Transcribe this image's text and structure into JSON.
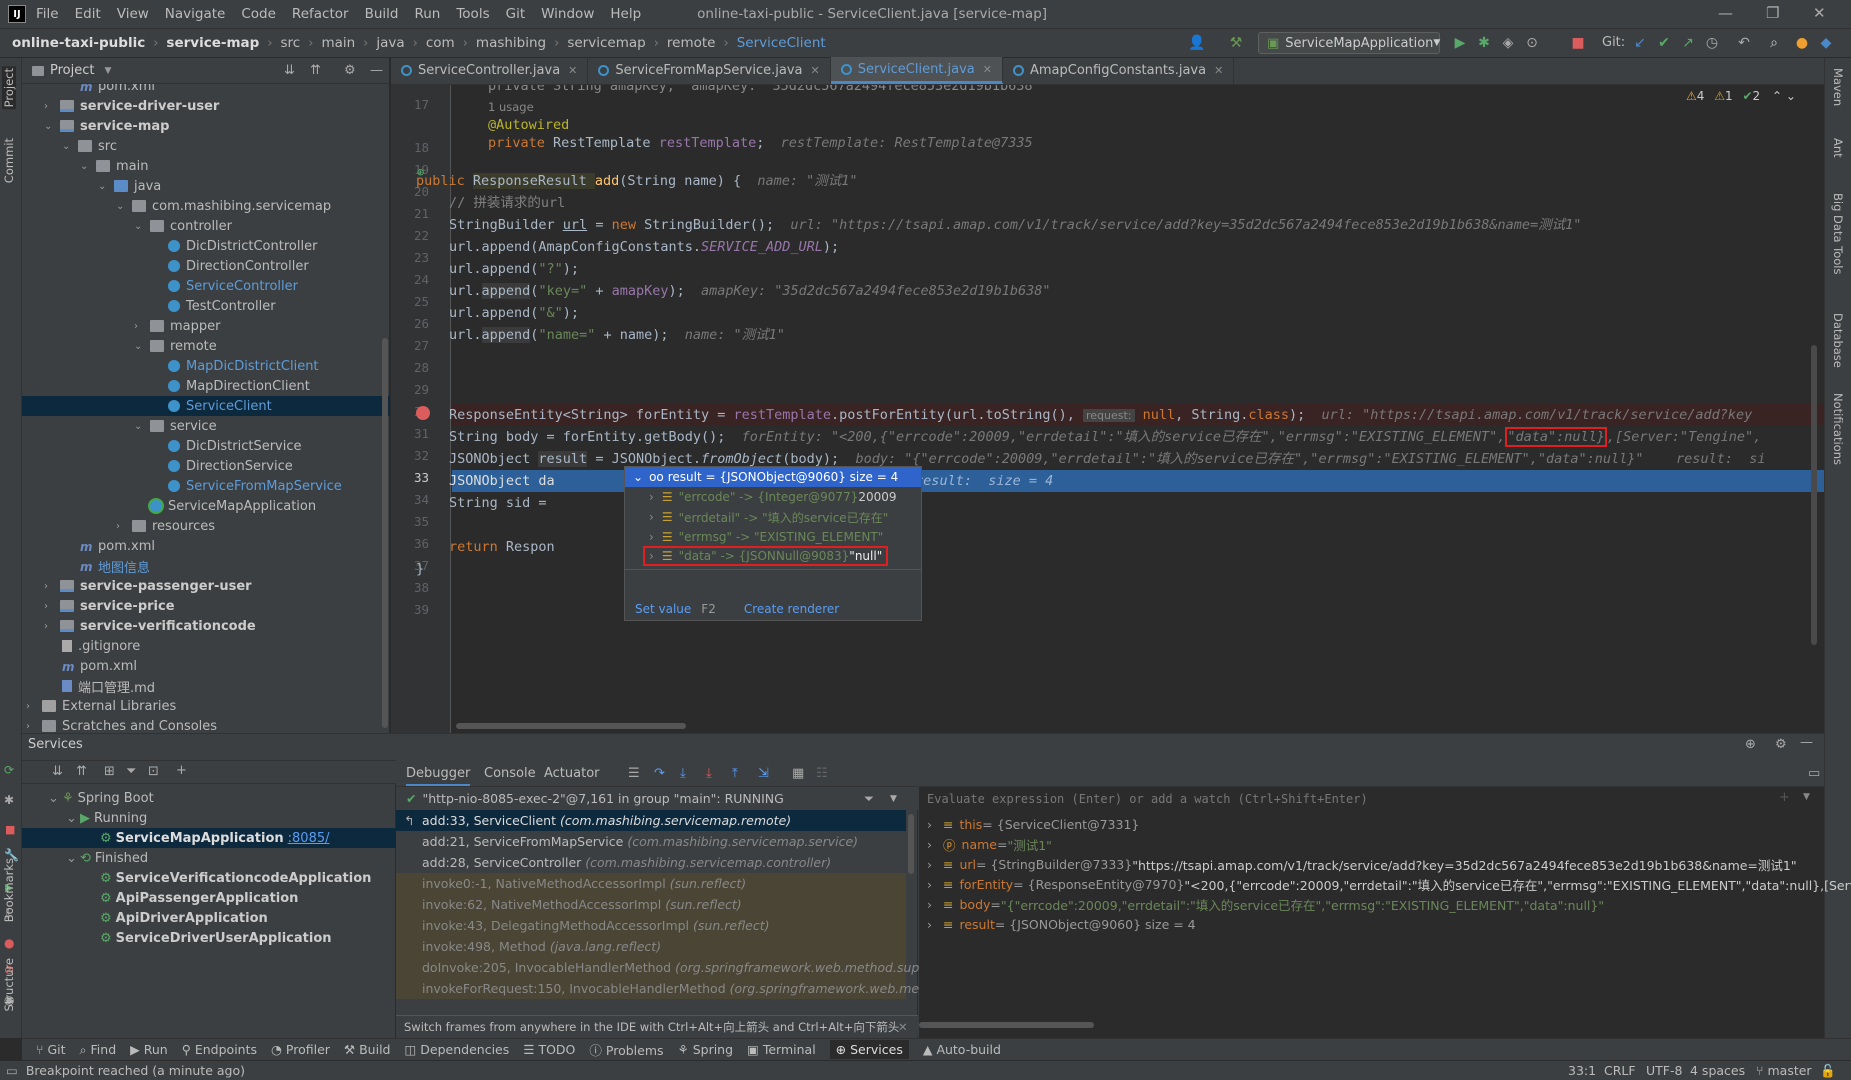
{
  "menu": {
    "items": [
      "File",
      "Edit",
      "View",
      "Navigate",
      "Code",
      "Refactor",
      "Build",
      "Run",
      "Tools",
      "Git",
      "Window",
      "Help"
    ],
    "window_title": "online-taxi-public - ServiceClient.java [service-map]"
  },
  "nav": {
    "crumbs": [
      "online-taxi-public",
      "service-map",
      "src",
      "main",
      "java",
      "com",
      "mashibing",
      "servicemap",
      "remote",
      "ServiceClient"
    ],
    "run_config": "ServiceMapApplication",
    "git_label": "Git:"
  },
  "project": {
    "title": "Project",
    "items": [
      {
        "t": "pom.xml"
      },
      {
        "t": "service-driver-user"
      },
      {
        "t": "service-map"
      },
      {
        "t": "src"
      },
      {
        "t": "main"
      },
      {
        "t": "java"
      },
      {
        "t": "com.mashibing.servicemap"
      },
      {
        "t": "controller"
      },
      {
        "t": "DicDistrictController"
      },
      {
        "t": "DirectionController"
      },
      {
        "t": "ServiceController"
      },
      {
        "t": "TestController"
      },
      {
        "t": "mapper"
      },
      {
        "t": "remote"
      },
      {
        "t": "MapDicDistrictClient"
      },
      {
        "t": "MapDirectionClient"
      },
      {
        "t": "ServiceClient"
      },
      {
        "t": "service"
      },
      {
        "t": "DicDistrictService"
      },
      {
        "t": "DirectionService"
      },
      {
        "t": "ServiceFromMapService"
      },
      {
        "t": "ServiceMapApplication"
      },
      {
        "t": "resources"
      },
      {
        "t": "pom.xml"
      },
      {
        "t": "地图信息"
      },
      {
        "t": "service-passenger-user"
      },
      {
        "t": "service-price"
      },
      {
        "t": "service-verificationcode"
      },
      {
        "t": ".gitignore"
      },
      {
        "t": "pom.xml"
      },
      {
        "t": "端口管理.md"
      },
      {
        "t": "External Libraries"
      },
      {
        "t": "Scratches and Consoles"
      }
    ]
  },
  "tabs": [
    "ServiceController.java",
    "ServiceFromMapService.java",
    "ServiceClient.java",
    "AmapConfigConstants.java"
  ],
  "editor": {
    "inspections": {
      "warn": "4",
      "weak": "1",
      "ok": "2"
    },
    "usage": "1 usage",
    "lines": [
      "17",
      "18",
      "19",
      "20",
      "21",
      "22",
      "23",
      "24",
      "25",
      "26",
      "27",
      "28",
      "29",
      "30",
      "31",
      "32",
      "33",
      "34",
      "35",
      "36",
      "37",
      "38",
      "39"
    ],
    "code": {
      "l17": "private String amapKey;  amapKey: \"35d2dc567a2494fece853e2d19b1b638\"",
      "l18a": "@Autowired",
      "l19a": "private ",
      "l19b": "RestTemplate ",
      "l19c": "restTemplate",
      "l19d": ";",
      "l19h": "restTemplate: RestTemplate@7335",
      "l21a": "public ",
      "l21b": "ResponseResult ",
      "l21c": "add",
      "l21d": "(String name) {",
      "l21h": "name: \"测试1\"",
      "l22": "// 拼装请求的url",
      "l23a": "StringBuilder ",
      "l23b": "url",
      " l23c": " = ",
      "l23d": "new ",
      "l23e": "StringBuilder();",
      "l23h": "url: \"https://tsapi.amap.com/v1/track/service/add?key=35d2dc567a2494fece853e2d19b1b638&name=测试1\"",
      "l24a": "url.append(AmapConfigConstants.",
      "l24b": "SERVICE_ADD_URL",
      "l24c": ");",
      "l25a": "url.append(",
      "l25b": "\"?\"",
      "l25c": ");",
      "l26a": "url.",
      "l26b": "append",
      "l26c": "(",
      "l26d": "\"key=\"",
      "l26e": " + ",
      "l26f": "amapKey",
      "l26g": ");",
      "l26h": "amapKey: \"35d2dc567a2494fece853e2d19b1b638\"",
      "l27a": "url.append(",
      "l27b": "\"&\"",
      "l27c": ");",
      "l28a": "url.",
      "l28b": "append",
      "l28c": "(",
      "l28d": "\"name=\"",
      "l28e": " + name);",
      "l28h": "name: \"测试1\"",
      "l30a": "ResponseEntity<String> forEntity = ",
      "l30b": "restTemplate",
      "l30c": ".postForEntity(url.toString(), ",
      "l30r": "request:",
      "l30d": " null",
      ", l30e": ", String.",
      "l30f": "class",
      "l30g": ");",
      "l30h": "url: \"https://tsapi.amap.com/v1/track/service/add?key",
      "l31a": "String body = forEntity.getBody();",
      "l31h": "forEntity: \"<200,{\"errcode\":20009,\"errdetail\":\"填入的service已存在\",\"errmsg\":\"EXISTING_ELEMENT\",",
      "l31r": "\"data\":null}",
      "l31t": ",[Server:\"Tengine\",",
      "l32a": "JSONObject ",
      "l32b": "result",
      " l32c": " = JSONObject.",
      "l32d": "fromObject",
      "l32e": "(body);",
      "l32h": "body: \"{\"errcode\":20009,\"errdetail\":\"填入的service已存在\",\"errmsg\":\"EXISTING_ELEMENT\",\"data\":null}\"    result:  si",
      "l33a": "JSONObject da",
      "l33h": ";  result:  size = 4",
      "l34a": "String sid = ",
      "l36a": "return ",
      "l36b": "Respon",
      "l37": "}",
      "l38": "}"
    }
  },
  "popup": {
    "header": "result = {JSONObject@9060}  size = 4",
    "rows": [
      {
        "k": "\"errcode\" -> {Integer@9077} ",
        "v": "20009"
      },
      {
        "k": "\"errdetail\" -> \"填入的service已存在\"",
        "v": ""
      },
      {
        "k": "\"errmsg\" -> \"EXISTING_ELEMENT\"",
        "v": ""
      },
      {
        "k": "\"data\" -> {JSONNull@9083} ",
        "v": "\"null\""
      }
    ],
    "set_value": "Set value",
    "set_value_key": "F2",
    "create_renderer": "Create renderer"
  },
  "services": {
    "title": "Services",
    "tree": {
      "spring_boot": "Spring Boot",
      "running": "Running",
      "app": "ServiceMapApplication",
      "port": ":8085/",
      "finished": "Finished",
      "finished_apps": [
        "ServiceVerificationcodeApplication",
        "ApiPassengerApplication",
        "ApiDriverApplication",
        "ServiceDriverUserApplication"
      ]
    },
    "debug_tabs": [
      "Debugger",
      "Console",
      "Actuator"
    ],
    "thread": "\"http-nio-8085-exec-2\"@7,161 in group \"main\": RUNNING",
    "frames": [
      {
        "m": "add:33, ServiceClient",
        "p": "(com.mashibing.servicemap.remote)"
      },
      {
        "m": "add:21, ServiceFromMapService",
        "p": "(com.mashibing.servicemap.service)"
      },
      {
        "m": "add:28, ServiceController",
        "p": "(com.mashibing.servicemap.controller)"
      },
      {
        "m": "invoke0:-1, NativeMethodAccessorImpl",
        "p": "(sun.reflect)"
      },
      {
        "m": "invoke:62, NativeMethodAccessorImpl",
        "p": "(sun.reflect)"
      },
      {
        "m": "invoke:43, DelegatingMethodAccessorImpl",
        "p": "(sun.reflect)"
      },
      {
        "m": "invoke:498, Method",
        "p": "(java.lang.reflect)"
      },
      {
        "m": "doInvoke:205, InvocableHandlerMethod",
        "p": "(org.springframework.web.method.support)"
      },
      {
        "m": "invokeForRequest:150, InvocableHandlerMethod",
        "p": "(org.springframework.web.method."
      }
    ],
    "frames_hint": "Switch frames from anywhere in the IDE with Ctrl+Alt+向上箭头 and Ctrl+Alt+向下箭头",
    "eval_placeholder": "Evaluate expression (Enter) or add a watch (Ctrl+Shift+Enter)",
    "vars": [
      {
        "n": "this",
        "t": " = {ServiceClient@7331}",
        "v": ""
      },
      {
        "n": "name",
        "t": " = ",
        "v": "\"测试1\""
      },
      {
        "n": "url",
        "t": " = {StringBuilder@7333} ",
        "v": "\"https://tsapi.amap.com/v1/track/service/add?key=35d2dc567a2494fece853e2d19b1b638&name=测试1\""
      },
      {
        "n": "forEntity",
        "t": " = {ResponseEntity@7970} ",
        "v": "\"<200,{\"errcode\":20009,\"errdetail\":\"填入的service已存在\",\"errmsg\":\"EXISTING_ELEMENT\",\"data\":null},[Serve ... View"
      },
      {
        "n": "body",
        "t": " = ",
        "v": "\"{\"errcode\":20009,\"errdetail\":\"填入的service已存在\",\"errmsg\":\"EXISTING_ELEMENT\",\"data\":null}\""
      },
      {
        "n": "result",
        "t": " = {JSONObject@9060}  size = 4",
        "v": ""
      }
    ]
  },
  "bottom_tools": [
    "Git",
    "Find",
    "Run",
    "Endpoints",
    "Profiler",
    "Build",
    "Dependencies",
    "TODO",
    "Problems",
    "Spring",
    "Terminal",
    "Services",
    "Auto-build"
  ],
  "left_stripe": [
    "Project",
    "Commit",
    "Bookmarks",
    "Structure"
  ],
  "right_stripe": [
    "Maven",
    "Ant",
    "Big Data Tools",
    "Database",
    "Notifications"
  ],
  "status": {
    "message": "Breakpoint reached (a minute ago)",
    "pos": "33:1",
    "sep": "CRLF",
    "enc": "UTF-8",
    "indent": "4 spaces",
    "branch": "master"
  }
}
